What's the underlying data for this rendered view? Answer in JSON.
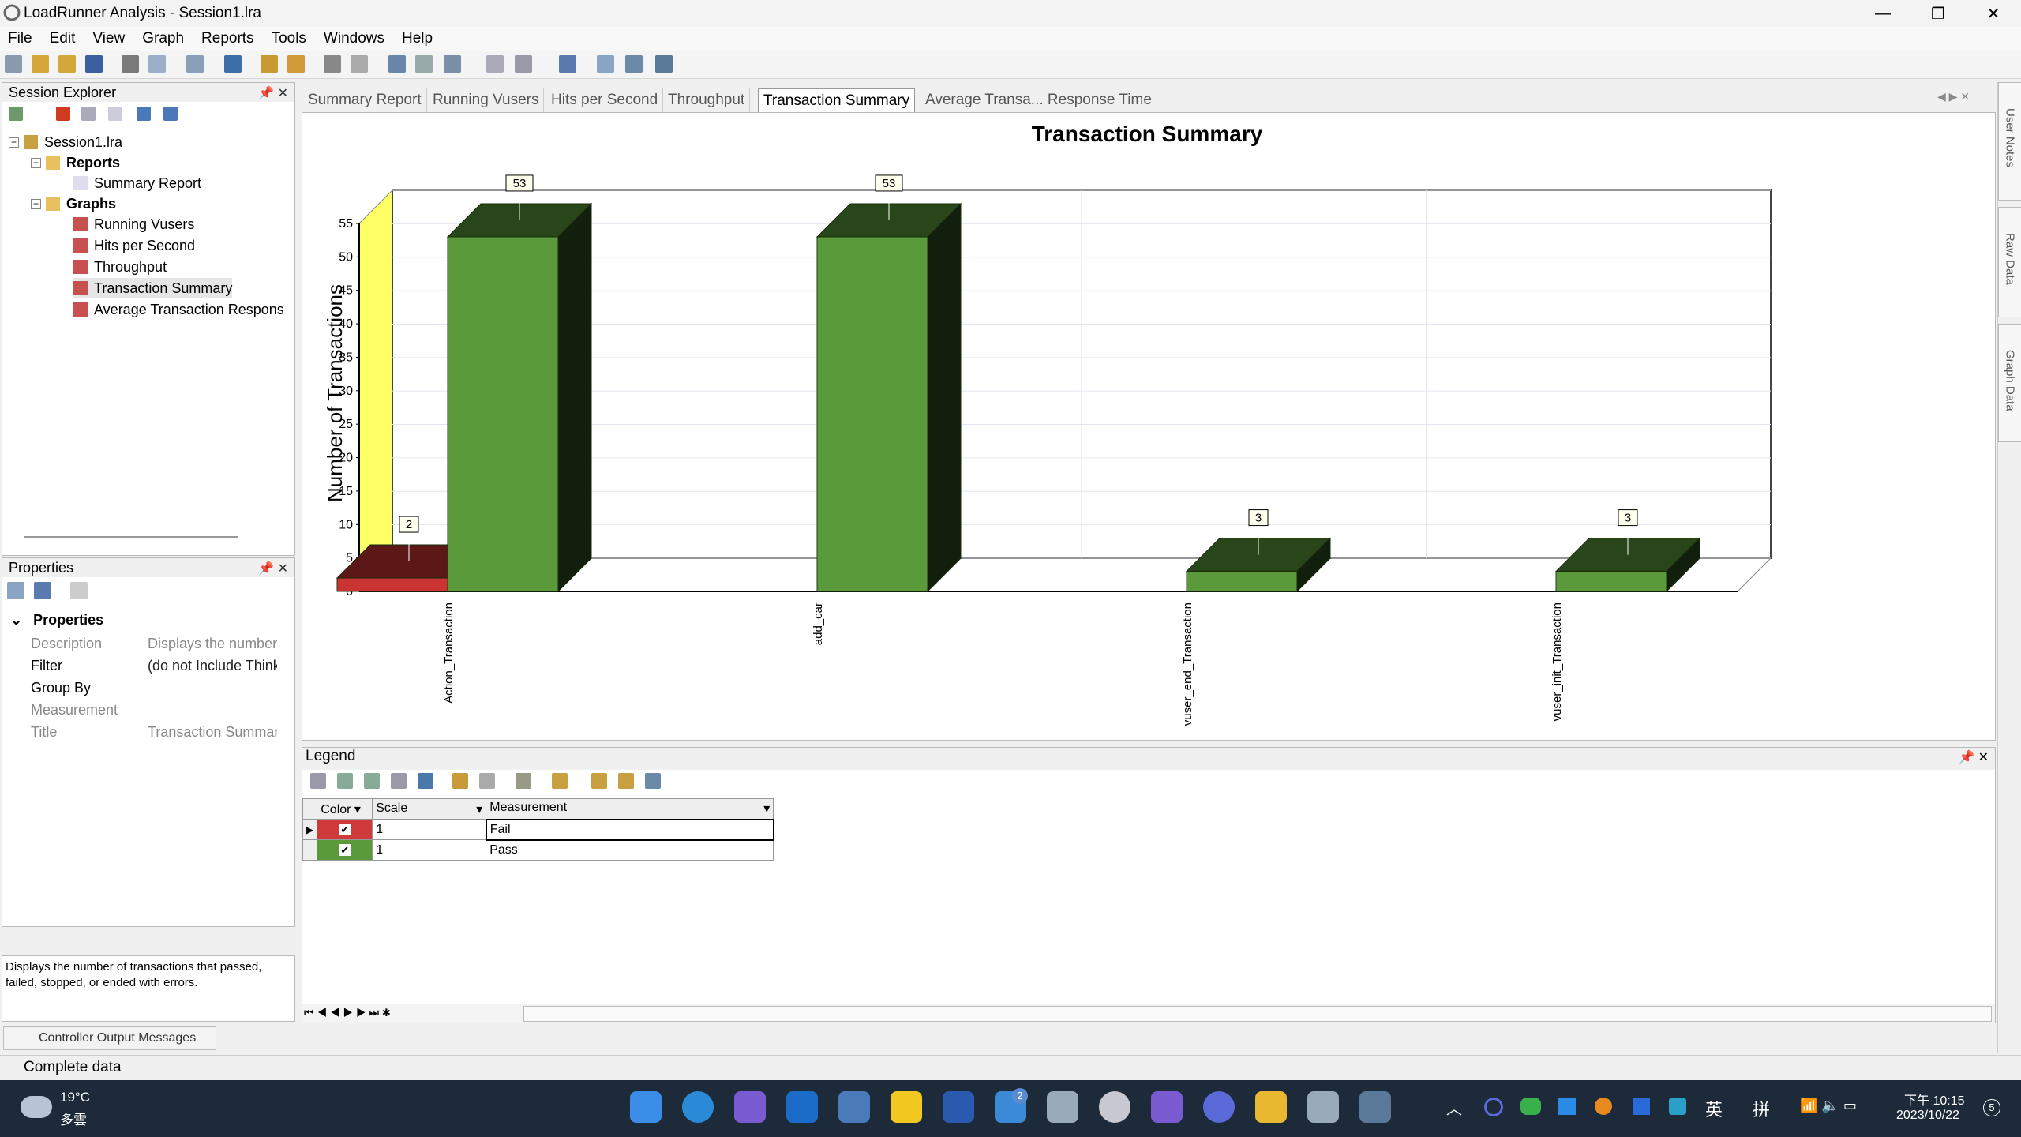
{
  "window": {
    "title": "LoadRunner Analysis - Session1.lra",
    "controls": [
      "—",
      "❐",
      "✕"
    ]
  },
  "menu": [
    "File",
    "Edit",
    "View",
    "Graph",
    "Reports",
    "Tools",
    "Windows",
    "Help"
  ],
  "session_explorer": {
    "title": "Session Explorer",
    "tree": {
      "root": "Session1.lra",
      "reports_label": "Reports",
      "reports": [
        "Summary Report"
      ],
      "graphs_label": "Graphs",
      "graphs": [
        "Running Vusers",
        "Hits per Second",
        "Throughput",
        "Transaction Summary",
        "Average Transaction Respons"
      ]
    }
  },
  "properties": {
    "title": "Properties",
    "section": "Properties",
    "rows": [
      {
        "key": "Description",
        "value": "Displays the number",
        "disabled": true
      },
      {
        "key": "Filter",
        "value": "(do not Include Think",
        "disabled": false
      },
      {
        "key": "Group By",
        "value": "",
        "disabled": false
      },
      {
        "key": "Measurement Bı",
        "value": "",
        "disabled": true
      },
      {
        "key": "Title",
        "value": "Transaction Summary",
        "disabled": true
      }
    ],
    "description_box": "Displays the number of transactions that passed, failed, stopped, or ended with errors."
  },
  "controller_tab": "Controller Output Messages",
  "status": "Complete data",
  "doc_tabs": [
    "Summary Report",
    "Running Vusers",
    "Hits per Second",
    "Throughput",
    "Transaction Summary",
    "Average Transa... Response Time"
  ],
  "active_tab": "Transaction Summary",
  "chart_data": {
    "type": "bar",
    "title": "Transaction Summary",
    "ylabel": "Number of Transactions",
    "xlabel": "",
    "categories": [
      "Action_Transaction",
      "add_car",
      "vuser_end_Transaction",
      "vuser_init_Transaction"
    ],
    "series": [
      {
        "name": "Fail",
        "color": "#cc3333",
        "values": [
          2,
          0,
          0,
          0
        ]
      },
      {
        "name": "Pass",
        "color": "#5a9a3a",
        "values": [
          53,
          53,
          3,
          3
        ]
      }
    ],
    "ylim": [
      0,
      55
    ],
    "yticks": [
      0,
      5,
      10,
      15,
      20,
      25,
      30,
      35,
      40,
      45,
      50,
      55
    ],
    "grid": true,
    "style": "3d"
  },
  "legend": {
    "title": "Legend",
    "columns": [
      "Color",
      "Scale",
      "Measurement"
    ],
    "rows": [
      {
        "color": "#d03a3a",
        "checked": true,
        "scale": "1",
        "measurement": "Fail"
      },
      {
        "color": "#5a9a3a",
        "checked": true,
        "scale": "1",
        "measurement": "Pass"
      }
    ]
  },
  "right_tabs": [
    "User Notes",
    "Raw Data",
    "Graph Data"
  ],
  "taskbar": {
    "weather_temp": "19°C",
    "weather_desc": "多雲",
    "ime1": "英",
    "ime2": "拼",
    "time": "下午 10:15",
    "date": "2023/10/22",
    "notification_count": "5",
    "badge": "2"
  }
}
